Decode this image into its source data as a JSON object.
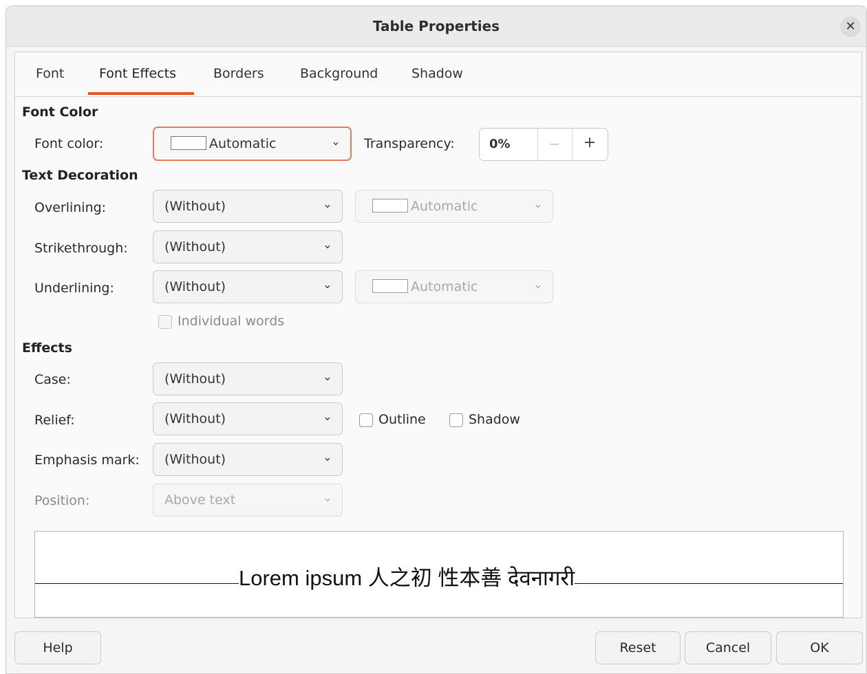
{
  "dialog": {
    "title": "Table Properties",
    "close_glyph": "✕"
  },
  "tabs": [
    {
      "label": "Font"
    },
    {
      "label": "Font Effects",
      "active": true
    },
    {
      "label": "Borders"
    },
    {
      "label": "Background"
    },
    {
      "label": "Shadow"
    }
  ],
  "font_color": {
    "section": "Font Color",
    "label": "Font color:",
    "value": "Automatic",
    "transparency_label": "Transparency:",
    "transparency_value": "0%",
    "minus_glyph": "−",
    "plus_glyph": "+"
  },
  "text_decoration": {
    "section": "Text Decoration",
    "overlining_label": "Overlining:",
    "overlining_value": "(Without)",
    "overline_color": "Automatic",
    "strikethrough_label": "Strikethrough:",
    "strikethrough_value": "(Without)",
    "underlining_label": "Underlining:",
    "underlining_value": "(Without)",
    "underline_color": "Automatic",
    "individual_words": "Individual words"
  },
  "effects": {
    "section": "Effects",
    "case_label": "Case:",
    "case_value": "(Without)",
    "relief_label": "Relief:",
    "relief_value": "(Without)",
    "outline_label": "Outline",
    "shadow_label": "Shadow",
    "emphasis_label": "Emphasis mark:",
    "emphasis_value": "(Without)",
    "position_label": "Position:",
    "position_value": "Above text"
  },
  "preview": {
    "text": "Lorem ipsum   人之初 性本善  देवनागरी"
  },
  "buttons": {
    "help": "Help",
    "reset": "Reset",
    "cancel": "Cancel",
    "ok": "OK"
  },
  "icons": {
    "chevron": "⌄"
  },
  "colors": {
    "accent": "#e95420",
    "focus_border": "#e57b5b"
  }
}
